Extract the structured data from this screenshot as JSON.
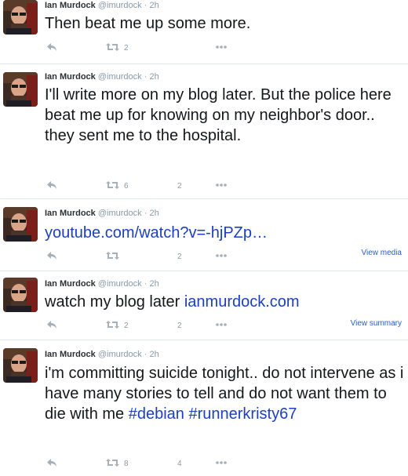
{
  "tweets": [
    {
      "name": "Ian Murdock",
      "handle": "@imurdock",
      "separator": "·",
      "time": "2h",
      "text": "Then beat me up some more.",
      "retweets": "2",
      "favorites": ""
    },
    {
      "name": "Ian Murdock",
      "handle": "@imurdock",
      "separator": "·",
      "time": "2h",
      "text": "I'll write more on my blog later. But the police here beat me up for knowing on my neighbor's door.. they sent me to the hospital.",
      "retweets": "6",
      "favorites": "2"
    },
    {
      "name": "Ian Murdock",
      "handle": "@imurdock",
      "separator": "·",
      "time": "2h",
      "link": "youtube.com/watch?v=-hjPZp…",
      "retweets": "",
      "favorites": "2",
      "side_link": "View media"
    },
    {
      "name": "Ian Murdock",
      "handle": "@imurdock",
      "separator": "·",
      "time": "2h",
      "text": "watch my blog later ",
      "link": "ianmurdock.com",
      "retweets": "2",
      "favorites": "2",
      "side_link": "View summary"
    },
    {
      "name": "Ian Murdock",
      "handle": "@imurdock",
      "separator": "·",
      "time": "2h",
      "text": "i'm committing suicide tonight.. do not intervene as i have many stories to tell and do not want them to die with me ",
      "hashtag1": "#debian",
      "hashtag2": "#runnerkristy67",
      "retweets": "8",
      "favorites": "4"
    }
  ],
  "icons": {
    "reply": "reply-icon",
    "retweet": "retweet-icon",
    "more": "more-icon"
  },
  "colors": {
    "link": "#1b3fbf",
    "muted": "#8899a6",
    "divider": "#e1e8ed"
  }
}
